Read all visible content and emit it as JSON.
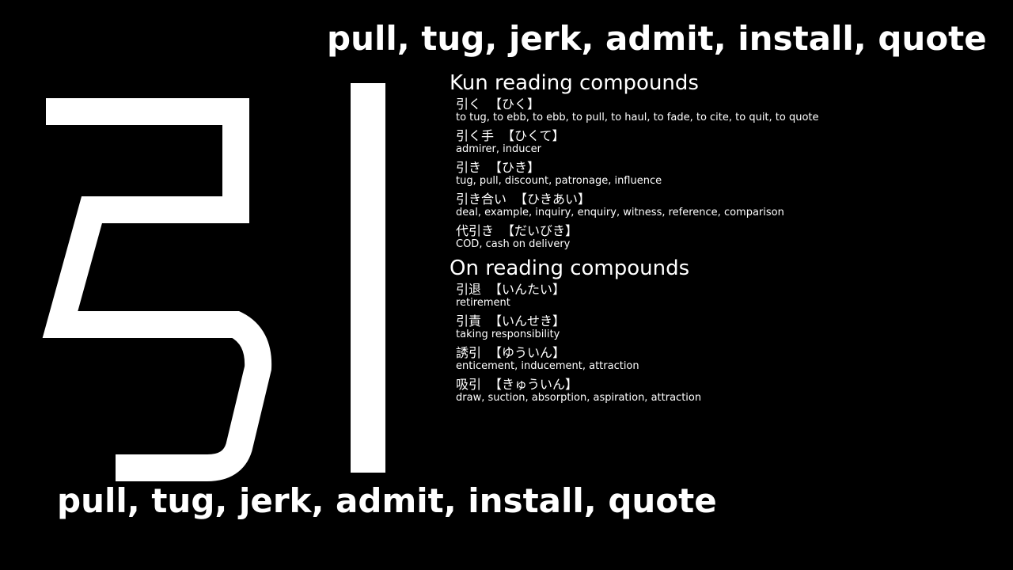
{
  "meaning_top": "pull, tug, jerk, admit, install, quote",
  "meaning_bottom": "pull, tug, jerk, admit, install, quote",
  "kanji": "引",
  "colors": {
    "background": "#000000",
    "text": "#ffffff"
  },
  "kun": {
    "title": "Kun reading compounds",
    "items": [
      {
        "word": "引く",
        "reading": "【ひく】",
        "meaning": "to tug, to ebb, to ebb, to pull, to haul, to fade, to cite, to quit, to quote"
      },
      {
        "word": "引く手",
        "reading": "【ひくて】",
        "meaning": "admirer, inducer"
      },
      {
        "word": "引き",
        "reading": "【ひき】",
        "meaning": "tug, pull, discount, patronage, influence"
      },
      {
        "word": "引き合い",
        "reading": "【ひきあい】",
        "meaning": "deal, example, inquiry, enquiry, witness, reference, comparison"
      },
      {
        "word": "代引き",
        "reading": "【だいびき】",
        "meaning": "COD, cash on delivery"
      }
    ]
  },
  "on": {
    "title": "On reading compounds",
    "items": [
      {
        "word": "引退",
        "reading": "【いんたい】",
        "meaning": "retirement"
      },
      {
        "word": "引責",
        "reading": "【いんせき】",
        "meaning": "taking responsibility"
      },
      {
        "word": "誘引",
        "reading": "【ゆういん】",
        "meaning": "enticement, inducement, attraction"
      },
      {
        "word": "吸引",
        "reading": "【きゅういん】",
        "meaning": "draw, suction, absorption, aspiration, attraction"
      }
    ]
  }
}
